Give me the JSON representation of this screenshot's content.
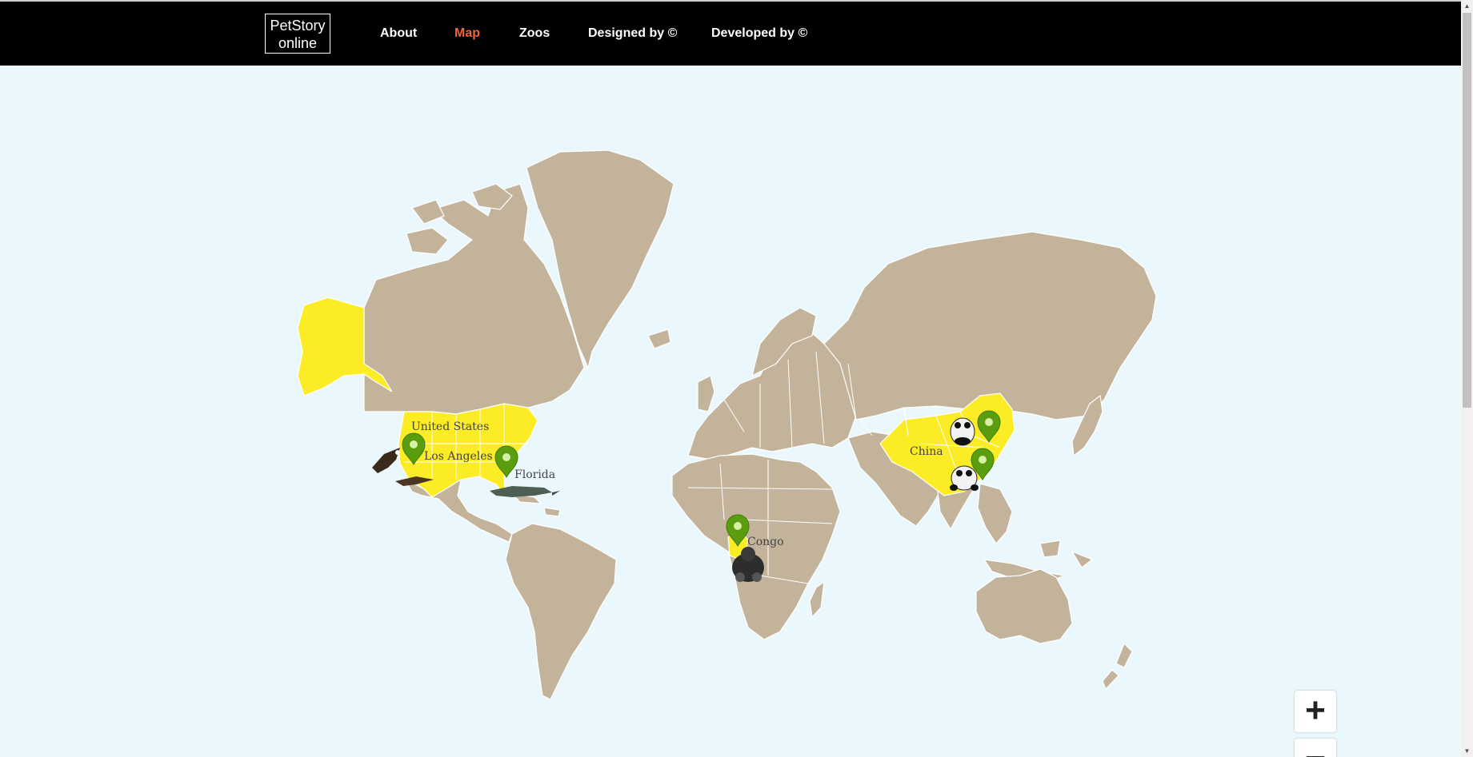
{
  "brand": {
    "line1": "PetStory",
    "line2": "online"
  },
  "nav": {
    "items": [
      {
        "label": "About",
        "active": false
      },
      {
        "label": "Map",
        "active": true
      },
      {
        "label": "Zoos",
        "active": false
      },
      {
        "label": "Designed by ©",
        "active": false
      },
      {
        "label": "Developed by ©",
        "active": false
      }
    ]
  },
  "map": {
    "highlighted_regions": [
      "United States",
      "China",
      "Congo"
    ],
    "labels": {
      "united_states": "United States",
      "los_angeles": "Los Angeles",
      "florida": "Florida",
      "congo": "Congo",
      "china": "China"
    },
    "markers": [
      {
        "place": "Los Angeles",
        "animal": "eagle"
      },
      {
        "place": "Florida",
        "animal": "alligator"
      },
      {
        "place": "Congo",
        "animal": "gorilla"
      },
      {
        "place": "China",
        "animal": "panda"
      },
      {
        "place": "China",
        "animal": "panda"
      }
    ],
    "colors": {
      "ocean": "#eaf7fd",
      "land": "#c2b39a",
      "highlight": "#fbec25",
      "marker": "#5a9d0e"
    }
  },
  "zoom": {
    "in_label": "+",
    "out_label": "−"
  },
  "icons": {
    "marker": "map-pin-icon",
    "zoom_in": "plus-icon",
    "zoom_out": "minus-icon"
  }
}
